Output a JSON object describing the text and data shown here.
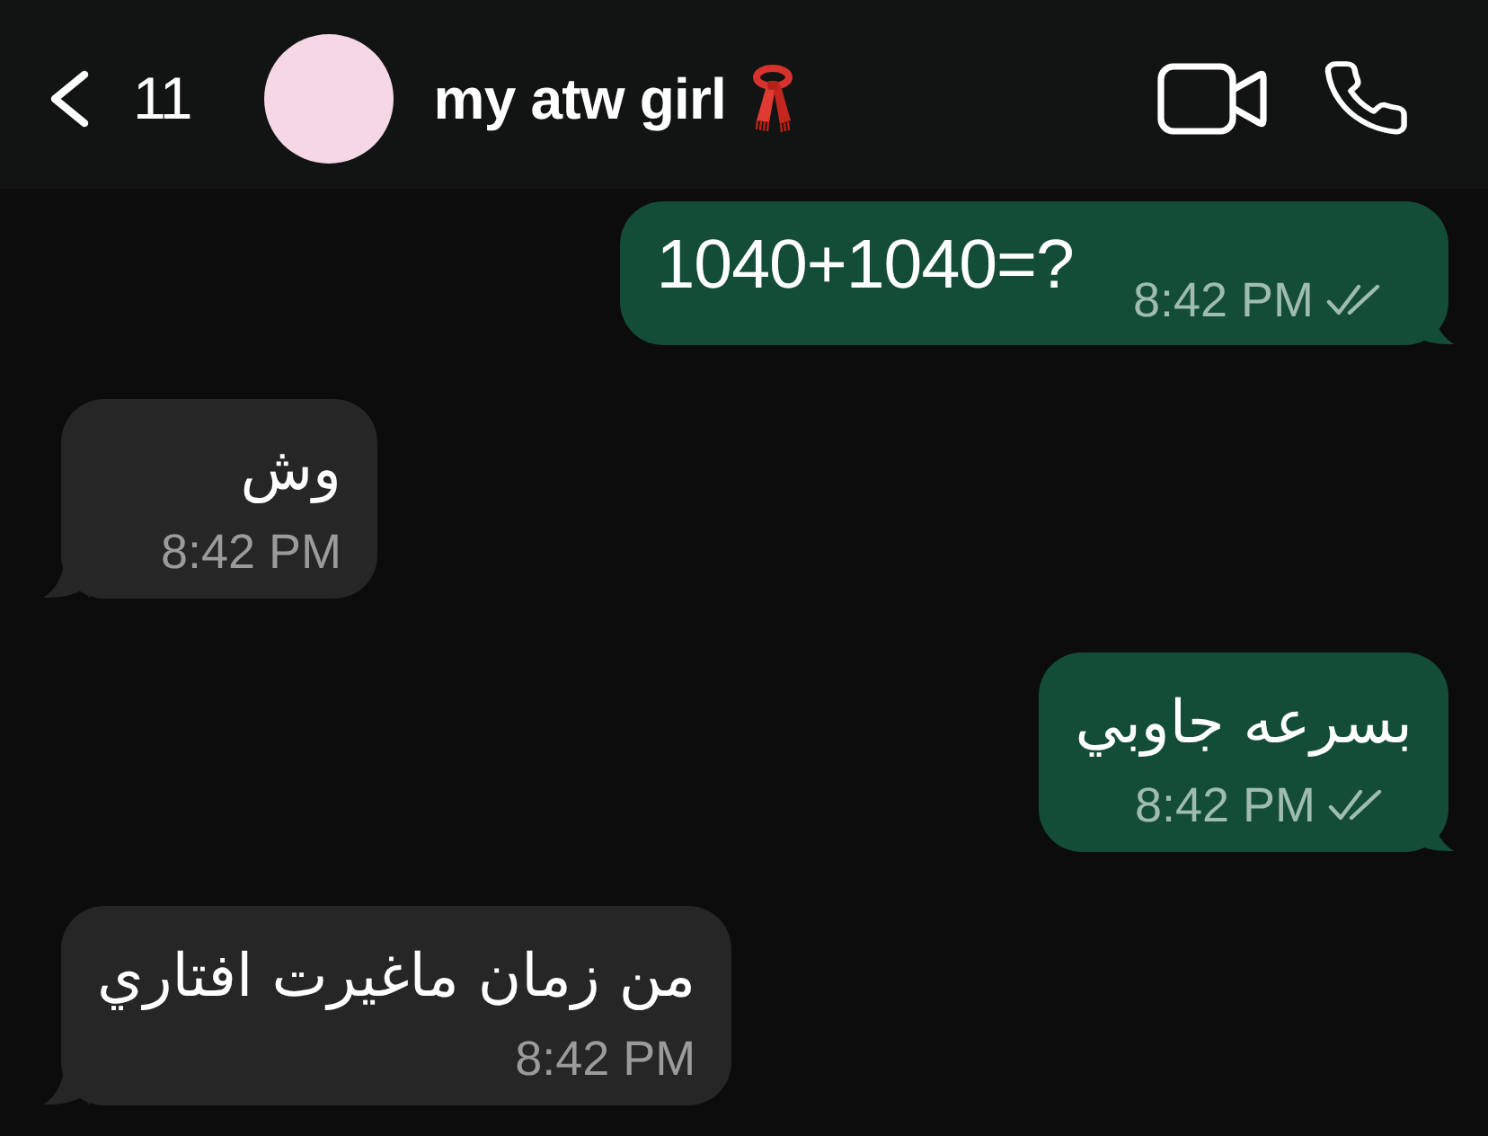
{
  "header": {
    "back_count": "11",
    "contact_name": "my atw girl"
  },
  "messages": [
    {
      "outgoing": true,
      "time_inline": true,
      "rtl": false,
      "text": "1040+1040=?",
      "time": "8:42 PM",
      "read": false
    },
    {
      "outgoing": false,
      "time_inline": false,
      "rtl": true,
      "text": "وش",
      "time": "8:42 PM"
    },
    {
      "outgoing": true,
      "time_inline": false,
      "rtl": true,
      "text": "بسرعه جاوبي",
      "time": "8:42 PM",
      "read": false
    },
    {
      "outgoing": false,
      "time_inline": false,
      "rtl": true,
      "text": "من زمان ماغيرت افتاري",
      "time": "8:42 PM"
    }
  ]
}
